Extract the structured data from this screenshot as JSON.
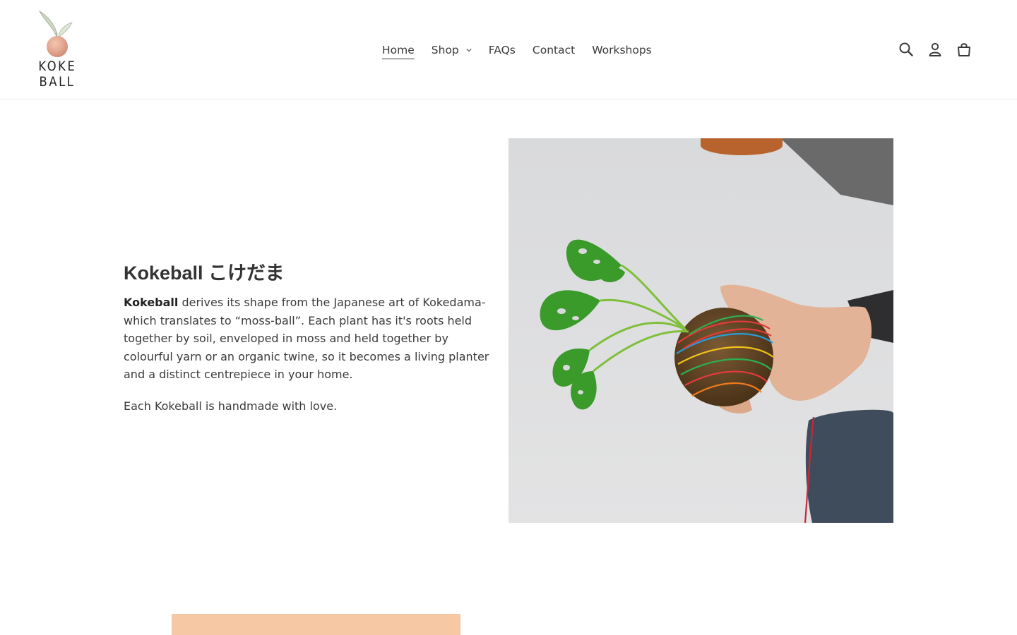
{
  "brand": {
    "logo_line1": "KOKE",
    "logo_line2": "BALL"
  },
  "nav": {
    "items": [
      {
        "label": "Home",
        "active": true
      },
      {
        "label": "Shop",
        "has_dropdown": true
      },
      {
        "label": "FAQs"
      },
      {
        "label": "Contact"
      },
      {
        "label": "Workshops"
      }
    ]
  },
  "header_icons": [
    "search-icon",
    "account-icon",
    "cart-icon"
  ],
  "hero": {
    "title": "Kokeball こけだま",
    "body_bold": "Kokeball",
    "body_text": " derives its shape from the Japanese art of Kokedama- which translates to “moss-ball”. Each plant has it's roots held together by soil, enveloped in moss and held together by colourful yarn or an organic twine, so it becomes a living planter and a distinct centrepiece in your home.",
    "tagline": "Each Kokeball is handmade with love."
  },
  "colors": {
    "text": "#3a3a3a",
    "peach_accent": "#f6c9a4"
  }
}
